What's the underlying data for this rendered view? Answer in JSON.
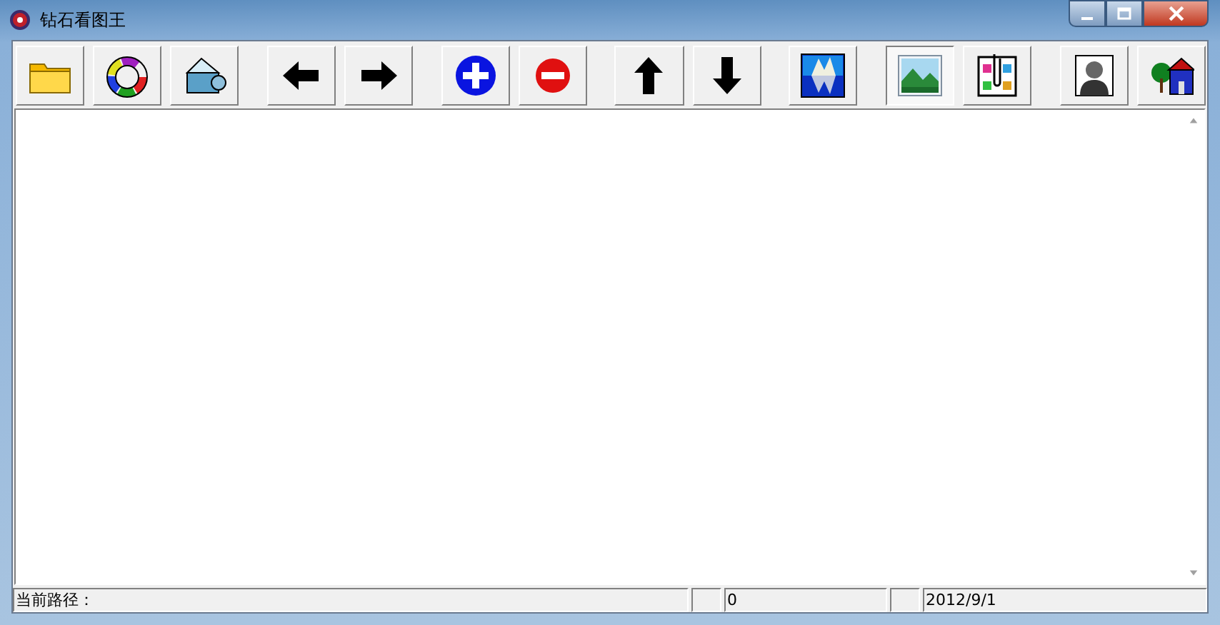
{
  "window": {
    "title": "钻石看图王"
  },
  "toolbar": [
    {
      "kind": "folder",
      "selected": false
    },
    {
      "kind": "ring",
      "selected": false
    },
    {
      "kind": "frame",
      "selected": false
    },
    {
      "kind": "left",
      "selected": false
    },
    {
      "kind": "right",
      "selected": false
    },
    {
      "kind": "plus",
      "selected": false
    },
    {
      "kind": "minus",
      "selected": false
    },
    {
      "kind": "up",
      "selected": false
    },
    {
      "kind": "down",
      "selected": false
    },
    {
      "kind": "mirror",
      "selected": false
    },
    {
      "kind": "landscape",
      "selected": true
    },
    {
      "kind": "clipboard",
      "selected": false
    },
    {
      "kind": "person",
      "selected": false
    },
    {
      "kind": "house",
      "selected": false
    }
  ],
  "status_bar": [
    {
      "text": "当前路径：",
      "kind": "wide"
    },
    {
      "kind": "tiny"
    },
    {
      "text": "0",
      "kind": "mid"
    },
    {
      "kind": "tiny"
    },
    {
      "text": "2012/9/1",
      "kind": "date"
    }
  ]
}
